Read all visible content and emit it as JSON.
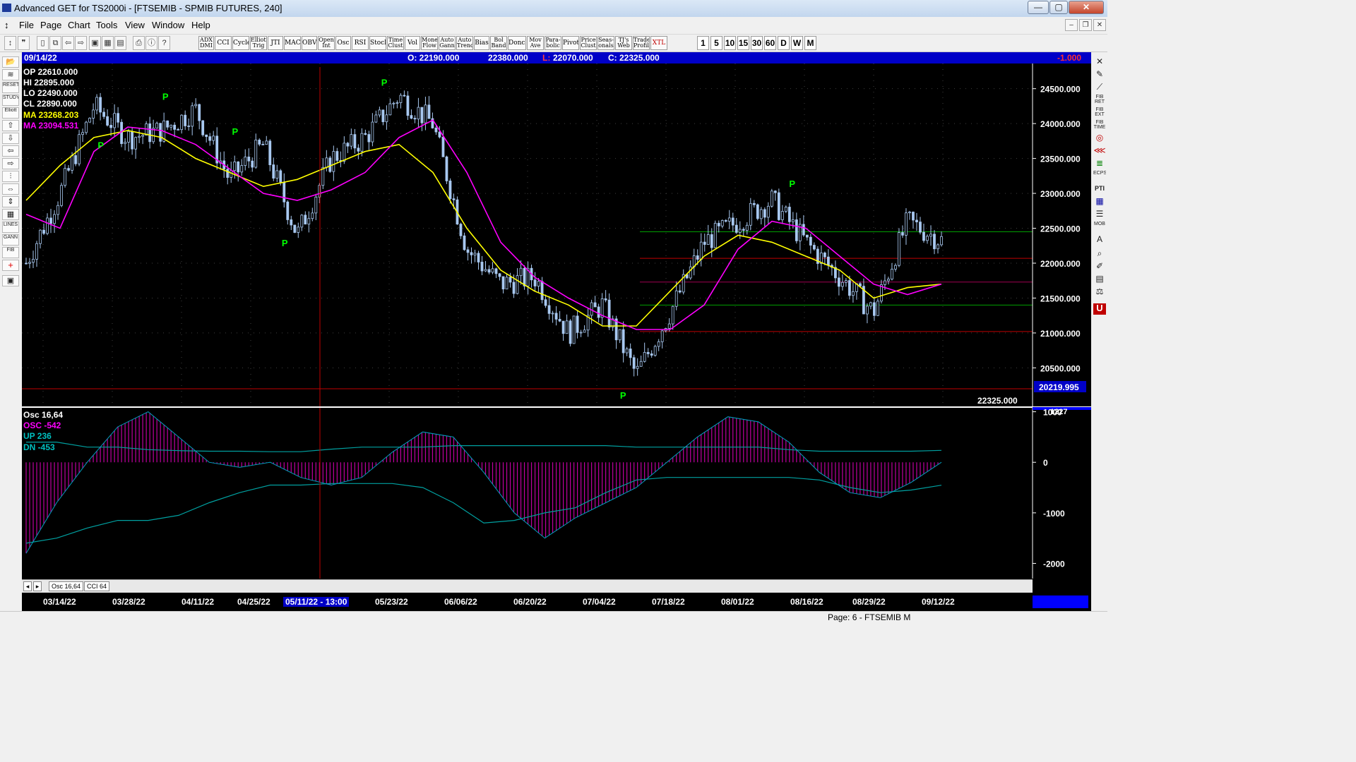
{
  "window": {
    "title": "Advanced GET for TS2000i - [FTSEMIB - SPMIB FUTURES, 240]",
    "minimize": "—",
    "maximize": "▢",
    "close": "✕"
  },
  "menubar": {
    "items": [
      "File",
      "Page",
      "Chart",
      "Tools",
      "View",
      "Window",
      "Help"
    ],
    "mdi_minimize": "–",
    "mdi_restore": "❐",
    "mdi_close": "✕"
  },
  "toolbar": {
    "study_buttons": [
      {
        "id": "adx-dmi",
        "label": "ADX\nDMI"
      },
      {
        "id": "cci",
        "label": "CCI"
      },
      {
        "id": "cycles",
        "label": "Cycles"
      },
      {
        "id": "elliott-trig",
        "label": "Elliott\nTrig"
      },
      {
        "id": "jti",
        "label": "JTI"
      },
      {
        "id": "macd",
        "label": "MACD"
      },
      {
        "id": "obv",
        "label": "OBV"
      },
      {
        "id": "open-int",
        "label": "Open\nInt"
      },
      {
        "id": "osc",
        "label": "Osc"
      },
      {
        "id": "rsi",
        "label": "RSI"
      },
      {
        "id": "stoch",
        "label": "Stoch"
      },
      {
        "id": "time-clust",
        "label": "Time\nClust"
      },
      {
        "id": "vol",
        "label": "Vol"
      },
      {
        "id": "money-flow",
        "label": "Money\nFlow"
      },
      {
        "id": "auto-gann",
        "label": "Auto\nGann"
      },
      {
        "id": "auto-trend",
        "label": "Auto\nTrend"
      },
      {
        "id": "bias",
        "label": "Bias"
      },
      {
        "id": "bol-band",
        "label": "Bol\nBand"
      },
      {
        "id": "donch",
        "label": "Donch"
      },
      {
        "id": "mov-ave",
        "label": "Mov\nAve"
      },
      {
        "id": "parabolic",
        "label": "Para-\nbolic"
      },
      {
        "id": "pivot",
        "label": "Pivot"
      },
      {
        "id": "price-clust",
        "label": "Price\nClust"
      },
      {
        "id": "seasonals",
        "label": "Seas-\nonals"
      },
      {
        "id": "tjs-web",
        "label": "TJ's\nWeb"
      },
      {
        "id": "trade-profile",
        "label": "Trade\nProfile"
      },
      {
        "id": "xtl",
        "label": "XTL"
      }
    ],
    "interval_buttons": [
      "1",
      "5",
      "10",
      "15",
      "30",
      "60",
      "D",
      "W",
      "M"
    ]
  },
  "left_tools": [
    "RESET",
    "STUDY",
    "Elliott",
    "LINES",
    "GANN",
    "FIB"
  ],
  "right_tools": [
    "FIB RET",
    "FIB EXT",
    "FIB TIME",
    "ECPS",
    "PTI",
    "MOB"
  ],
  "colors": {
    "candle": "#a8c8f0",
    "ma_fast": "#ffff00",
    "ma_slow": "#ff00ff",
    "pivot": "#00ff00",
    "osc_hist": "#c000a0",
    "band": "#00a0a0",
    "infobar": "#0000c8"
  },
  "infobar": {
    "date": "09/14/22",
    "open": "O: 22190.000",
    "high": "22380.000",
    "low_label": "L:",
    "low": "22070.000",
    "close": "C: 22325.000",
    "change": "-1.000"
  },
  "price_legend": {
    "op": "OP 22610.000",
    "hi": "HI 22895.000",
    "lo": "LO 22490.000",
    "cl": "CL 22890.000",
    "ma1": "MA 23268.203",
    "ma2": "MA 23094.531"
  },
  "osc_legend": {
    "title": "Osc 16,64",
    "osc": "OSC -542",
    "up": "UP 236",
    "dn": "DN -453"
  },
  "axis": {
    "price_ticks": [
      "24500.000",
      "24000.000",
      "23500.000",
      "23000.000",
      "22500.000",
      "22000.000",
      "21500.000",
      "21000.000",
      "20500.000"
    ],
    "low_label": "20219.995",
    "last_price": "22325.000",
    "osc_ticks": [
      "1000",
      "0",
      "-1000",
      "-2000"
    ],
    "osc_top": "1227",
    "dates": [
      "03/14/22",
      "03/28/22",
      "04/11/22",
      "04/25/22",
      "05/11/22 - 13:00",
      "05/23/22",
      "06/06/22",
      "06/20/22",
      "07/04/22",
      "07/18/22",
      "08/01/22",
      "08/16/22",
      "08/29/22",
      "09/12/22"
    ]
  },
  "pivot_label": "P",
  "tabs": [
    "Osc 16,64",
    "CCI 64"
  ],
  "status": "Page: 6 - FTSEMIB M",
  "chart_data": {
    "type": "line",
    "symbol": "FTSEMIB - SPMIB FUTURES, 240",
    "price_range": [
      20150,
      24800
    ],
    "x": [
      "03/14/22",
      "03/21/22",
      "03/28/22",
      "04/04/22",
      "04/11/22",
      "04/18/22",
      "04/25/22",
      "05/02/22",
      "05/11/22",
      "05/16/22",
      "05/23/22",
      "05/30/22",
      "06/06/22",
      "06/13/22",
      "06/20/22",
      "06/27/22",
      "07/04/22",
      "07/11/22",
      "07/18/22",
      "07/25/22",
      "08/01/22",
      "08/08/22",
      "08/16/22",
      "08/22/22",
      "08/29/22",
      "09/05/22",
      "09/12/22",
      "09/14/22"
    ],
    "series": [
      {
        "values": [
          22000,
          23000,
          24250,
          23800,
          23900,
          24200,
          23200,
          23700,
          22400,
          23500,
          23800,
          24400,
          24000,
          22200,
          21700,
          21800,
          21000,
          21400,
          20400,
          21300,
          22300,
          22600,
          22900,
          22300,
          21800,
          21300,
          22600,
          22325
        ]
      },
      {
        "values": [
          22900,
          23400,
          23800,
          23900,
          23800,
          23500,
          23300,
          23100,
          23200,
          23400,
          23600,
          23700,
          23300,
          22500,
          21900,
          21600,
          21400,
          21100,
          21100,
          21600,
          22100,
          22400,
          22300,
          22100,
          21900,
          21500,
          21650,
          21700
        ]
      },
      {
        "values": [
          22700,
          22500,
          23600,
          23950,
          23900,
          23700,
          23350,
          23000,
          22900,
          23050,
          23300,
          23800,
          24050,
          23300,
          22300,
          21800,
          21500,
          21250,
          21050,
          21050,
          21400,
          22200,
          22600,
          22500,
          22100,
          21700,
          21550,
          21700
        ]
      }
    ],
    "pivots": [
      {
        "x": "03/29/22",
        "y": 23600
      },
      {
        "x": "04/11/22",
        "y": 24300
      },
      {
        "x": "04/25/22",
        "y": 23800
      },
      {
        "x": "05/05/22",
        "y": 22200
      },
      {
        "x": "05/25/22",
        "y": 24500
      },
      {
        "x": "07/12/22",
        "y": 20200
      },
      {
        "x": "08/15/22",
        "y": 23050
      }
    ],
    "hlines": [
      {
        "y": 22450,
        "color": "#00a000"
      },
      {
        "y": 22070,
        "color": "#c00000"
      },
      {
        "y": 21730,
        "color": "#a00050"
      },
      {
        "y": 21400,
        "color": "#00a000"
      },
      {
        "y": 21020,
        "color": "#c00000"
      },
      {
        "y": 20200,
        "color": "#c00000"
      }
    ],
    "osc_range": [
      -2300,
      1050
    ],
    "osc": [
      -1800,
      -800,
      0,
      700,
      1000,
      500,
      0,
      -100,
      0,
      -300,
      -450,
      -300,
      200,
      600,
      500,
      -200,
      -1000,
      -1500,
      -1100,
      -800,
      -500,
      0,
      500,
      900,
      800,
      400,
      -200,
      -600,
      -700,
      -400,
      0
    ],
    "osc_up": [
      400,
      400,
      300,
      300,
      250,
      230,
      220,
      220,
      210,
      210,
      260,
      300,
      300,
      300,
      330,
      330,
      330,
      330,
      330,
      330,
      300,
      300,
      300,
      300,
      300,
      250,
      220,
      220,
      220,
      220,
      236
    ],
    "osc_dn": [
      -1600,
      -1500,
      -1300,
      -1150,
      -1150,
      -1050,
      -800,
      -600,
      -450,
      -450,
      -420,
      -420,
      -420,
      -500,
      -800,
      -1200,
      -1150,
      -1000,
      -900,
      -600,
      -350,
      -300,
      -300,
      -300,
      -300,
      -300,
      -350,
      -500,
      -600,
      -550,
      -453
    ],
    "osc_ticks": [
      1000,
      0,
      -1000,
      -2000
    ]
  }
}
